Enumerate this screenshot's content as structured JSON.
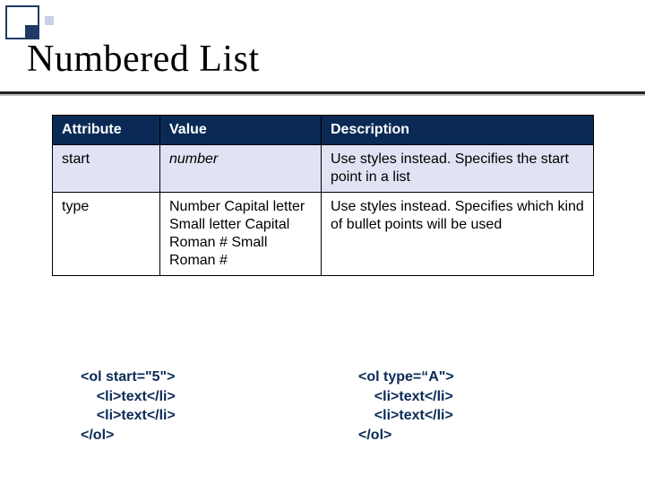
{
  "title": "Numbered List",
  "table": {
    "headers": {
      "c1": "Attribute",
      "c2": "Value",
      "c3": "Description"
    },
    "rows": [
      {
        "attr": "start",
        "value": "number",
        "desc": "Use styles instead.\nSpecifies the start point in a list"
      },
      {
        "attr": "type",
        "value": "Number\nCapital letter\nSmall letter\nCapital Roman #\nSmall Roman #",
        "desc": "Use styles instead.\nSpecifies which kind of bullet points will be used"
      }
    ]
  },
  "code": {
    "left": "<ol start=\"5\">\n    <li>text</li>\n    <li>text</li>\n</ol>",
    "right": "<ol type=“A\">\n    <li>text</li>\n    <li>text</li>\n</ol>"
  }
}
